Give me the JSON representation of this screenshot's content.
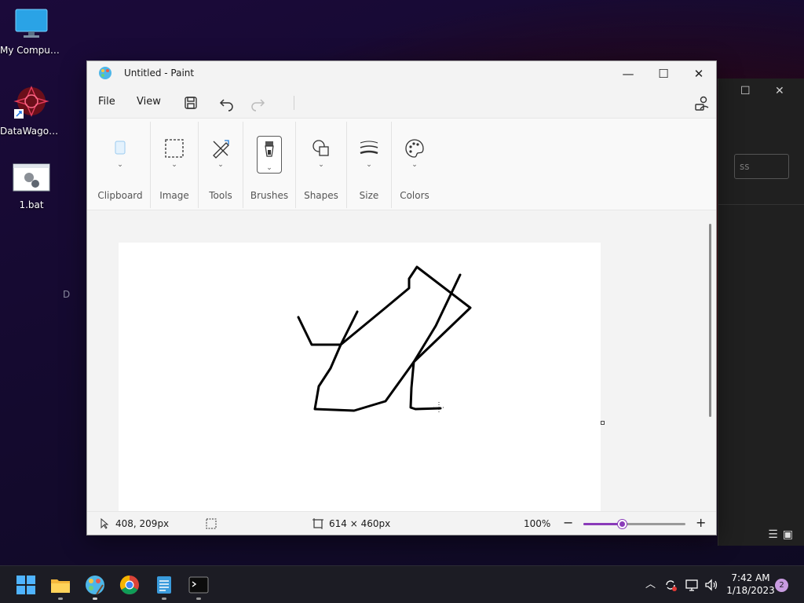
{
  "desktop": {
    "icons": [
      {
        "label": "My Computer"
      },
      {
        "label": "DataWagon..."
      },
      {
        "label": "1.bat"
      }
    ],
    "stray_text": "D"
  },
  "background_window": {
    "field_text": "ss"
  },
  "paint": {
    "title": "Untitled - Paint",
    "menu": {
      "file": "File",
      "view": "View"
    },
    "ribbon": {
      "groups": [
        {
          "label": "Clipboard",
          "icon": "clipboard-icon"
        },
        {
          "label": "Image",
          "icon": "select-icon"
        },
        {
          "label": "Tools",
          "icon": "tools-icon"
        },
        {
          "label": "Brushes",
          "icon": "brush-icon"
        },
        {
          "label": "Shapes",
          "icon": "shapes-icon"
        },
        {
          "label": "Size",
          "icon": "size-icon"
        },
        {
          "label": "Colors",
          "icon": "palette-icon"
        }
      ]
    },
    "status": {
      "cursor": "408, 209px",
      "canvas_size": "614 × 460px",
      "zoom": "100%",
      "zoom_fraction": 0.38
    },
    "accent_color": "#8a3ab9"
  },
  "taskbar": {
    "apps": [
      "start-icon",
      "file-explorer-icon",
      "paint-icon",
      "chrome-icon",
      "notepad-icon",
      "terminal-icon"
    ],
    "clock": {
      "time": "7:42 AM",
      "date": "1/18/2023"
    },
    "notifications": "2"
  }
}
